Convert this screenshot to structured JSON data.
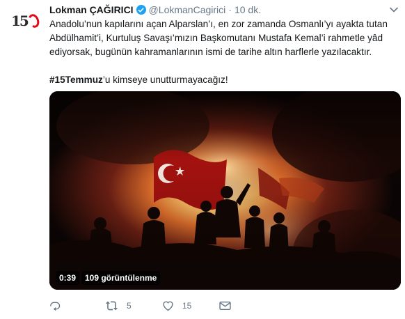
{
  "tweet": {
    "author_name": "Lokman ÇAĞIRICI",
    "handle": "@LokmanCagirici",
    "separator": "·",
    "time": "10 dk.",
    "avatar_text": "15",
    "text_line1": "Anadolu’nun kapılarını açan Alparslan’ı, en zor zamanda Osmanlı’yı ayakta tutan Abdülhamit’i, Kurtuluş Savaşı’mızın Başkomutanı Mustafa Kemal’i rahmetle yâd ediyorsak, bugünün kahramanlarının ismi de tarihe altın harflerle yazılacaktır.",
    "hashtag": "#15Temmuz",
    "text_line2_rest": "’u kimseye unutturmayacağız!"
  },
  "media": {
    "duration": "0:39",
    "views": "109 görüntülenme"
  },
  "actions": {
    "retweet_count": "5",
    "like_count": "15"
  },
  "icons": {
    "avatar": "15-temmuz-logo",
    "verified": "verified-badge-icon",
    "menu": "chevron-down-icon",
    "reply": "reply-icon",
    "retweet": "retweet-icon",
    "like": "heart-icon",
    "dm": "envelope-icon"
  },
  "colors": {
    "accent": "#1da1f2",
    "text": "#14171a",
    "muted": "#657786",
    "flag_red": "#e30a17"
  }
}
